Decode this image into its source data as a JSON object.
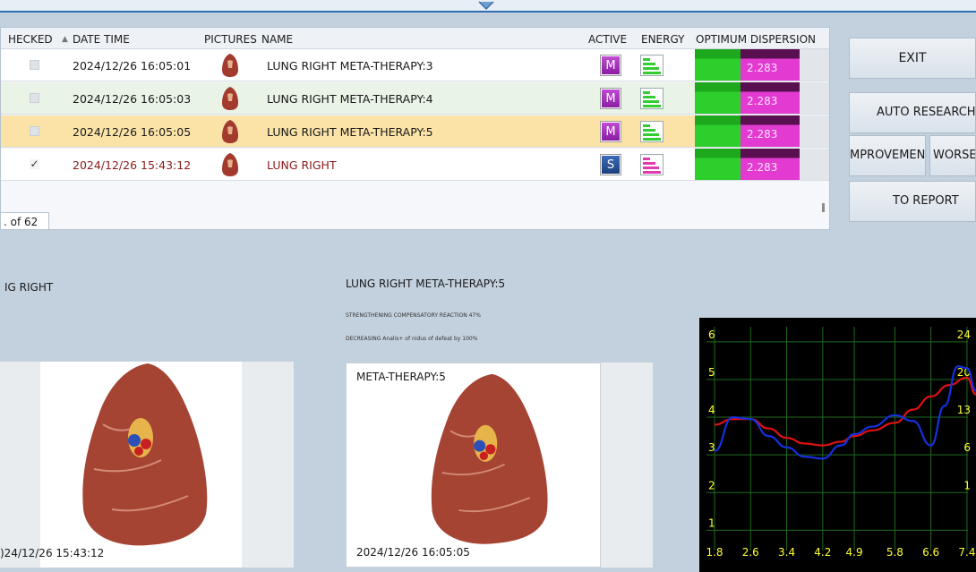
{
  "grid": {
    "columns": [
      "HECKED",
      "DATE TIME",
      "PICTURES",
      "NAME",
      "ACTIVE",
      "ENERGY",
      "OPTIMUM DISPERSION"
    ],
    "rows": [
      {
        "checked": false,
        "datetime": "2024/12/26 16:05:01",
        "name": "LUNG RIGHT META-THERAPY:3",
        "active": "M",
        "dispersion": "2.283"
      },
      {
        "checked": false,
        "datetime": "2024/12/26 16:05:03",
        "name": "LUNG RIGHT META-THERAPY:4",
        "active": "M",
        "dispersion": "2.283"
      },
      {
        "checked": false,
        "datetime": "2024/12/26 16:05:05",
        "name": "LUNG RIGHT META-THERAPY:5",
        "active": "M",
        "dispersion": "2.283"
      },
      {
        "checked": true,
        "check_mark": "✓",
        "datetime": "2024/12/26 15:43:12",
        "name": "LUNG RIGHT",
        "active": "S",
        "dispersion": "2.283"
      }
    ],
    "pager": ". of 62"
  },
  "buttons": {
    "exit": "EXIT",
    "auto_research": "AUTO RESEARCH",
    "improvement": "MPROVEMENT",
    "worsen": "WORSEN",
    "to_report": "TO REPORT"
  },
  "left_panel": {
    "title": "IG RIGHT",
    "timestamp": ")24/12/26 15:43:12"
  },
  "middle_panel": {
    "title": "LUNG RIGHT META-THERAPY:5",
    "line1": "STRENGTHENING COMPENSATORY REACTION 47%",
    "line2": "DECREASING Analis+ of nidus of defeat by 100%",
    "image_label": "META-THERAPY:5",
    "timestamp": "2024/12/26 16:05:05"
  },
  "colors": {
    "row_highlight": "#fbe3a8",
    "row_alt": "#e9f3e6",
    "checked_text": "#8b1a1a",
    "chart_grid": "#1f6b1f",
    "chart_axis_text": "#ffff33",
    "series_red": "#e01010",
    "series_blue": "#1530e0"
  },
  "chart_data": {
    "type": "line",
    "x_ticks": [
      "1.8",
      "2.6",
      "3.4",
      "4.2",
      "4.9",
      "5.8",
      "6.6",
      "7.4"
    ],
    "y_left_ticks": [
      "1",
      "2",
      "3",
      "4",
      "5",
      "6"
    ],
    "y_right_ticks": [
      "24",
      "20",
      "13",
      "6",
      "1"
    ],
    "ylim": [
      0.7,
      6.4
    ],
    "xlim": [
      1.8,
      7.6
    ],
    "series": [
      {
        "color": "red",
        "x": [
          1.8,
          2.2,
          2.6,
          3.0,
          3.4,
          3.8,
          4.2,
          4.6,
          4.9,
          5.3,
          5.8,
          6.2,
          6.6,
          7.0,
          7.4,
          7.6
        ],
        "values": [
          3.8,
          3.95,
          3.95,
          3.7,
          3.45,
          3.3,
          3.25,
          3.35,
          3.5,
          3.65,
          3.85,
          4.2,
          4.55,
          4.85,
          5.05,
          4.6
        ]
      },
      {
        "color": "blue",
        "x": [
          1.8,
          2.2,
          2.6,
          3.0,
          3.4,
          3.8,
          4.2,
          4.6,
          4.9,
          5.3,
          5.8,
          6.2,
          6.6,
          6.9,
          7.2,
          7.4,
          7.6
        ],
        "values": [
          3.1,
          4.0,
          3.95,
          3.5,
          3.2,
          2.95,
          2.9,
          3.25,
          3.55,
          3.75,
          4.05,
          3.9,
          3.25,
          4.3,
          5.35,
          5.3,
          4.7
        ]
      }
    ]
  }
}
